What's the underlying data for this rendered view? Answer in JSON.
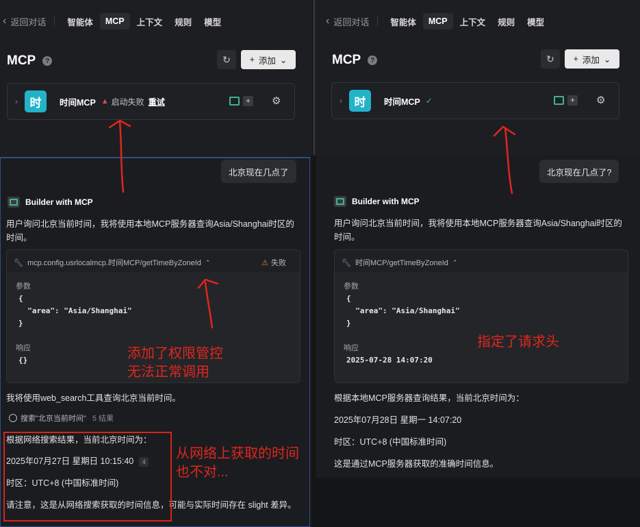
{
  "left": {
    "nav": {
      "back_label": "返回对话",
      "tabs": [
        "智能体",
        "MCP",
        "上下文",
        "规则",
        "模型"
      ],
      "active_tab": "MCP"
    },
    "header": {
      "title": "MCP",
      "add_label": "添加"
    },
    "server": {
      "avatar_text": "时",
      "name": "时间MCP",
      "status": "启动失败",
      "retry_label": "重试"
    },
    "chat": {
      "user_message": "北京现在几点了",
      "bot_name": "Builder with MCP",
      "intro": "用户询问北京当前时间，我将使用本地MCP服务器查询Asia/Shanghai时区的时间。",
      "tool_path": "mcp.config.usrlocalmcp.时间MCP/getTimeByZoneId",
      "tool_status": "失败",
      "params_label": "参数",
      "params_code": "{\n  \"area\": \"Asia/Shanghai\"\n}",
      "response_label": "响应",
      "response_code": "{}",
      "followup": "我将使用web_search工具查询北京当前时间。",
      "search_text": "搜索\"北京当前时间\"",
      "search_count": "5 结果",
      "result_intro": "根据网络搜索结果，当前北京时间为：",
      "result_time": "2025年07月27日 星期日 10:15:40",
      "result_cite": "4",
      "result_zone": "时区：UTC+8 (中国标准时间)",
      "note": "请注意，这是从网络搜索获取的时间信息，可能与实际时间存在 slight 差异。"
    },
    "annotations": {
      "permission": "添加了权限管控\n无法正常调用",
      "wrong_time": "从网络上获取的时间\n也不对..."
    }
  },
  "right": {
    "nav": {
      "back_label": "返回对话",
      "tabs": [
        "智能体",
        "MCP",
        "上下文",
        "规则",
        "模型"
      ],
      "active_tab": "MCP"
    },
    "header": {
      "title": "MCP",
      "add_label": "添加"
    },
    "server": {
      "avatar_text": "时",
      "name": "时间MCP",
      "status_icon": "✓"
    },
    "chat": {
      "user_message": "北京现在几点了?",
      "bot_name": "Builder with MCP",
      "intro": "用户询问北京当前时间，我将使用本地MCP服务器查询Asia/Shanghai时区的时间。",
      "tool_path": "时间MCP/getTimeByZoneId",
      "params_label": "参数",
      "params_code": "{\n  \"area\": \"Asia/Shanghai\"\n}",
      "response_label": "响应",
      "response_code": "2025-07-28 14:07:20",
      "result_intro": "根据本地MCP服务器查询结果，当前北京时间为：",
      "result_time": "2025年07月28日 星期一 14:07:20",
      "result_zone": "时区：UTC+8 (中国标准时间)",
      "closing": "这是通过MCP服务器获取的准确时间信息。"
    },
    "annotations": {
      "headers": "指定了请求头"
    }
  },
  "colors": {
    "accent_teal": "#23b3c9",
    "success_green": "#3fb68b",
    "error_red": "#e5484d",
    "annotation_red": "#e0261e"
  }
}
